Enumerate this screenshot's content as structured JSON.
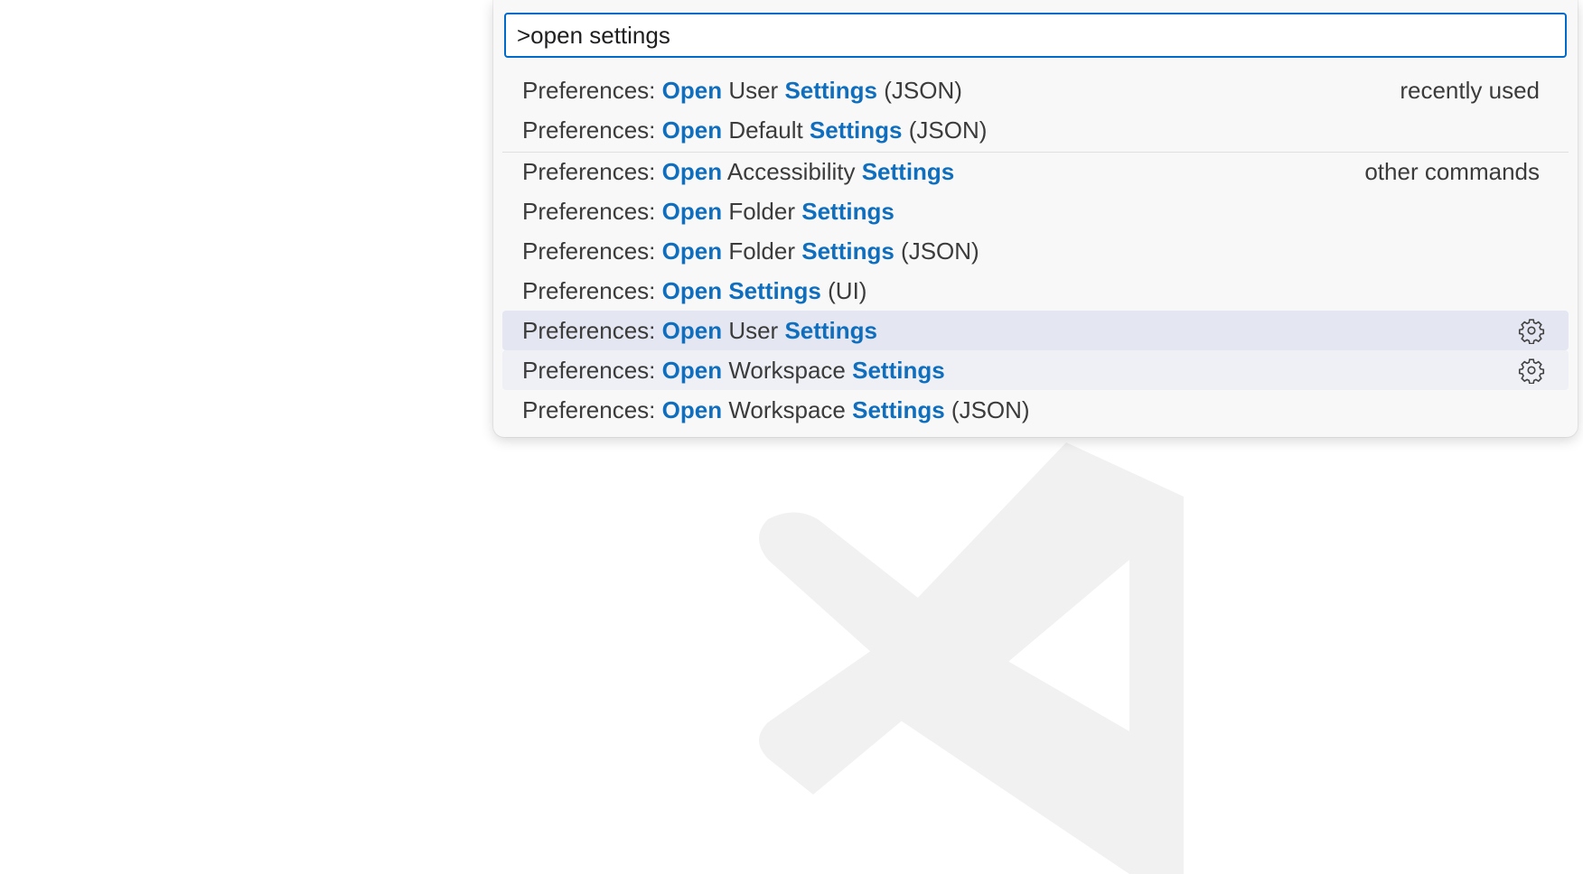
{
  "quick_open": {
    "input_value": ">open settings",
    "items": [
      {
        "prefix": "Preferences: ",
        "open": "Open",
        "mid": " User ",
        "settings": "Settings",
        "suffix": " (JSON)",
        "group": "recently used"
      },
      {
        "prefix": "Preferences: ",
        "open": "Open",
        "mid": " Default ",
        "settings": "Settings",
        "suffix": " (JSON)",
        "group": ""
      },
      {
        "prefix": "Preferences: ",
        "open": "Open",
        "mid": " Accessibility ",
        "settings": "Settings",
        "suffix": "",
        "group": "other commands"
      },
      {
        "prefix": "Preferences: ",
        "open": "Open",
        "mid": " Folder ",
        "settings": "Settings",
        "suffix": "",
        "group": ""
      },
      {
        "prefix": "Preferences: ",
        "open": "Open",
        "mid": " Folder ",
        "settings": "Settings",
        "suffix": " (JSON)",
        "group": ""
      },
      {
        "prefix": "Preferences: ",
        "open": "Open",
        "mid": " ",
        "settings": "Settings",
        "suffix": " (UI)",
        "group": ""
      },
      {
        "prefix": "Preferences: ",
        "open": "Open",
        "mid": " User ",
        "settings": "Settings",
        "suffix": "",
        "group": "",
        "icon": "gear-icon"
      },
      {
        "prefix": "Preferences: ",
        "open": "Open",
        "mid": " Workspace ",
        "settings": "Settings",
        "suffix": "",
        "group": "",
        "icon": "gear-icon"
      },
      {
        "prefix": "Preferences: ",
        "open": "Open",
        "mid": " Workspace ",
        "settings": "Settings",
        "suffix": " (JSON)",
        "group": ""
      }
    ]
  },
  "colors": {
    "highlight": "#0f6ebd",
    "focus_border": "#0069cc",
    "selected_row": "#e4e6f1"
  },
  "watermark": {
    "icon": "vscode-logo-watermark"
  }
}
